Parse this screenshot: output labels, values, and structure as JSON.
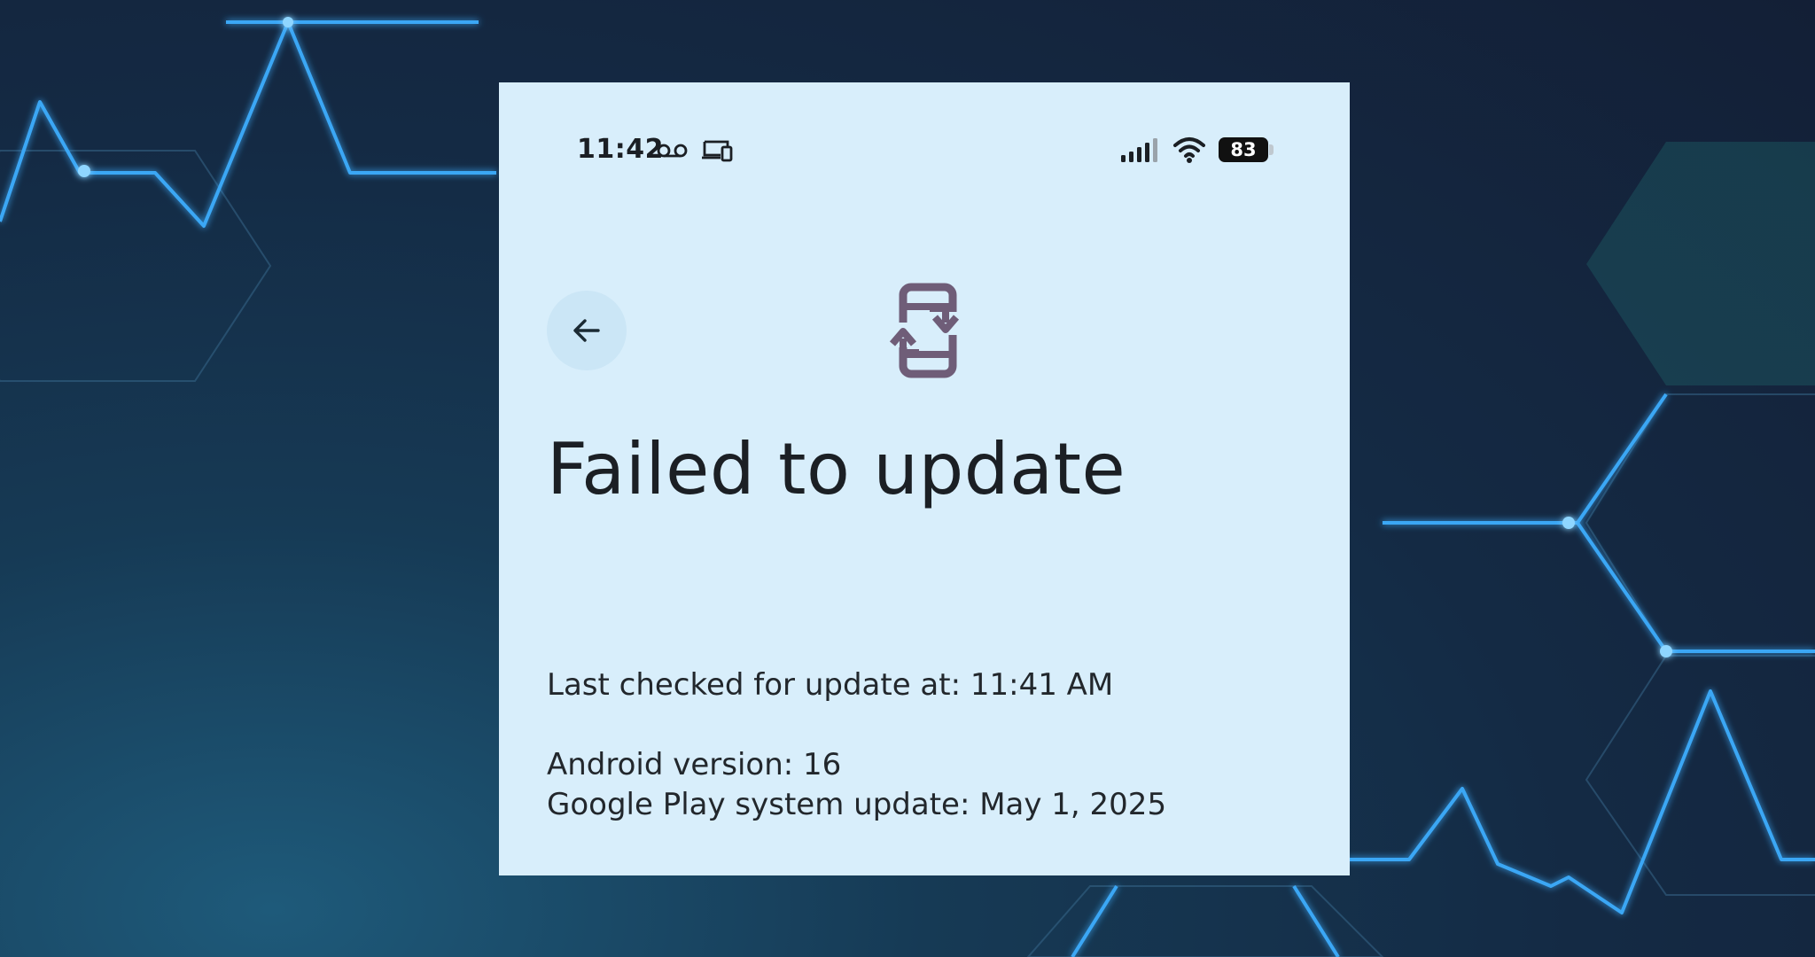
{
  "status_bar": {
    "time": "11:42",
    "icons": [
      "voicemail-icon",
      "devices-icon",
      "signal-icon",
      "wifi-icon"
    ],
    "battery_level": "83"
  },
  "page": {
    "title": "Failed to update",
    "back_icon": "arrow-back-icon",
    "hero_icon": "system-update-icon",
    "last_checked": "Last checked for update at: 11:41 AM",
    "android_version": "Android version: 16",
    "play_system_update": "Google Play system update: May 1, 2025"
  },
  "colors": {
    "card_background": "#d8eefb",
    "back_button_background": "#cbe6f6",
    "hero_icon": "#6f5d78",
    "text": "#1b1f24"
  }
}
